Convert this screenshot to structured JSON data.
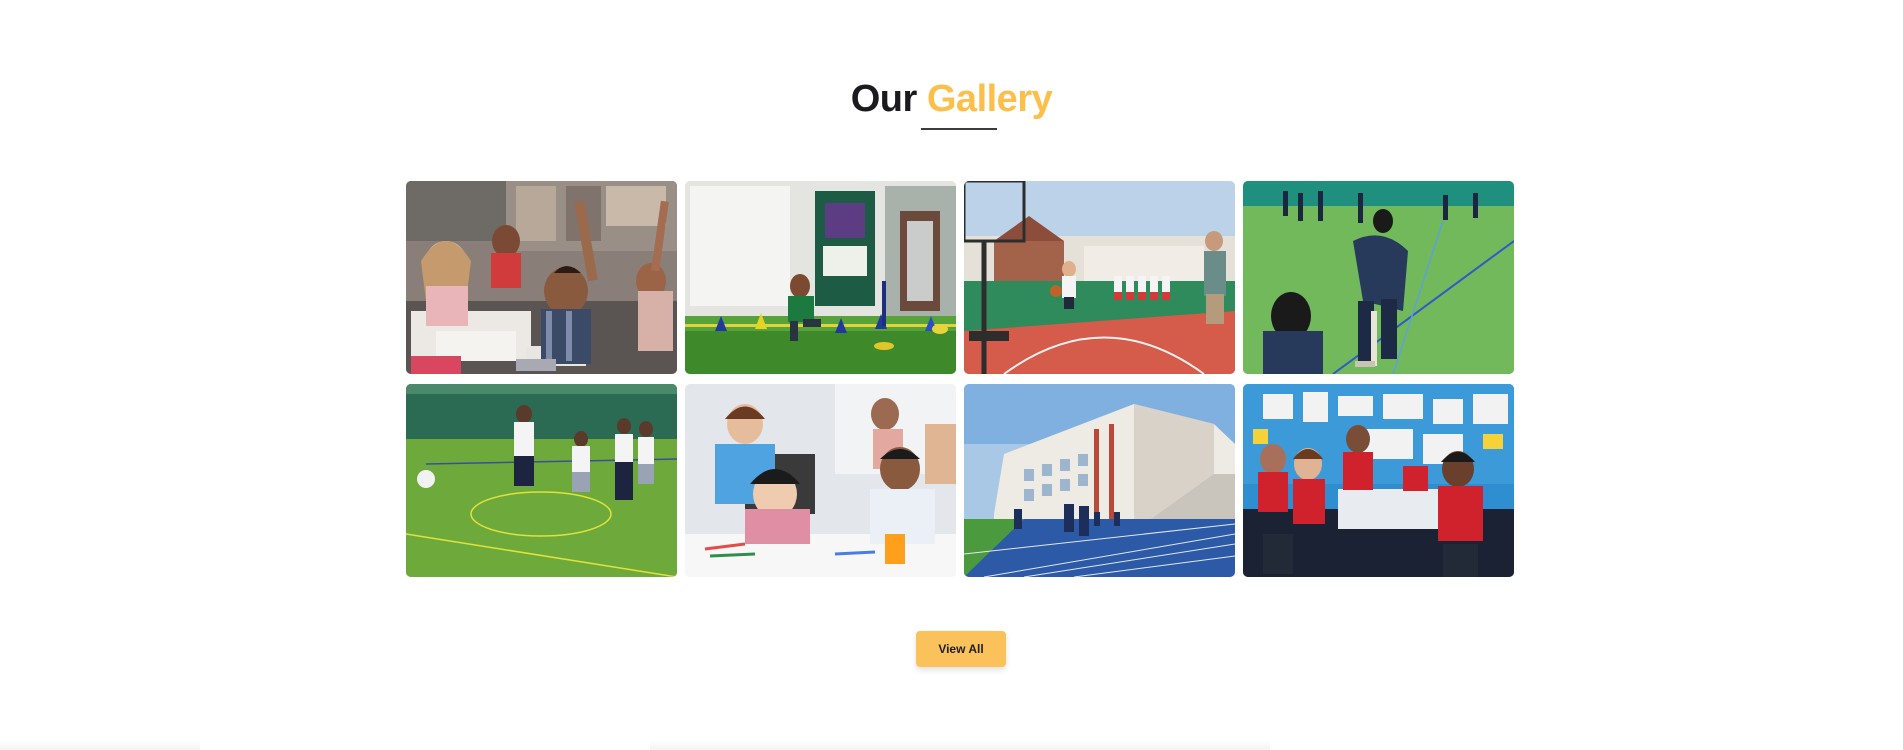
{
  "gallery_section": {
    "title_part1": "Our",
    "title_part2": "Gallery",
    "accent_color": "#fbbf4a",
    "view_all_label": "View All",
    "images": [
      {
        "subject": "classroom-hands-raised"
      },
      {
        "subject": "sports-day-obstacle-course"
      },
      {
        "subject": "basketball-court"
      },
      {
        "subject": "cricket-practice"
      },
      {
        "subject": "football-turf"
      },
      {
        "subject": "students-thumbs-up"
      },
      {
        "subject": "running-track-campus"
      },
      {
        "subject": "red-uniform-classroom"
      }
    ]
  }
}
